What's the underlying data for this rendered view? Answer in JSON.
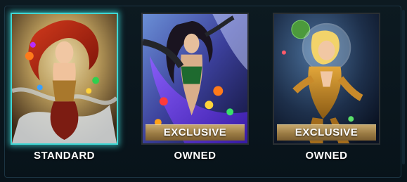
{
  "skins": [
    {
      "image": "red-haired goddess skin art",
      "badge": "",
      "label": "STANDARD",
      "selected": true
    },
    {
      "image": "dark-haired goddess skin art with colored gems",
      "badge": "EXCLUSIVE",
      "label": "OWNED",
      "selected": false
    },
    {
      "image": "blonde space-suit goddess skin art",
      "badge": "EXCLUSIVE",
      "label": "OWNED",
      "selected": false
    }
  ],
  "colors": {
    "selected_glow": "#3fd7d4",
    "badge_gold": "#b1925a",
    "background": "#0a1116"
  }
}
